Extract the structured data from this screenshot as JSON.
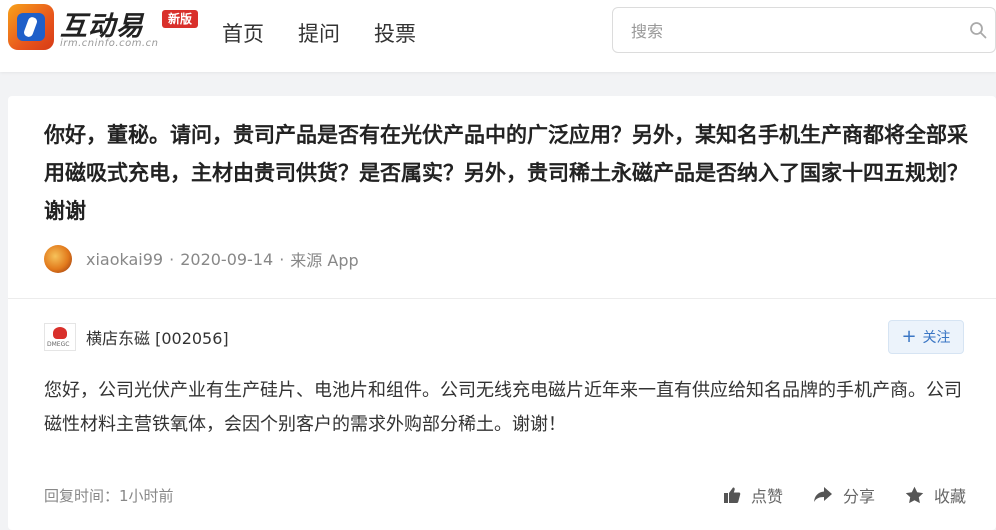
{
  "header": {
    "logo_text": "互动易",
    "logo_sub": "irm.cninfo.com.cn",
    "badge": "新版",
    "nav": [
      "首页",
      "提问",
      "投票"
    ],
    "search_placeholder": "搜索"
  },
  "question": {
    "text": "你好，董秘。请问，贵司产品是否有在光伏产品中的广泛应用？另外，某知名手机生产商都将全部采用磁吸式充电，主材由贵司供货？是否属实？另外，贵司稀土永磁产品是否纳入了国家十四五规划？谢谢",
    "author": "xiaokai99",
    "date": "2020-09-14",
    "source": "来源 App"
  },
  "answer": {
    "company": "横店东磁 [002056]",
    "company_logo_text": "DMEGC",
    "follow_label": "关注",
    "text": "您好，公司光伏产业有生产硅片、电池片和组件。公司无线充电磁片近年来一直有供应给知名品牌的手机产商。公司磁性材料主营铁氧体，会因个别客户的需求外购部分稀土。谢谢！",
    "reply_time": "回复时间：1小时前",
    "like_label": "点赞",
    "share_label": "分享",
    "favorite_label": "收藏"
  },
  "colors": {
    "brand_red": "#d9302b",
    "follow_blue": "#3a76c4",
    "background": "#f2f3f5"
  }
}
